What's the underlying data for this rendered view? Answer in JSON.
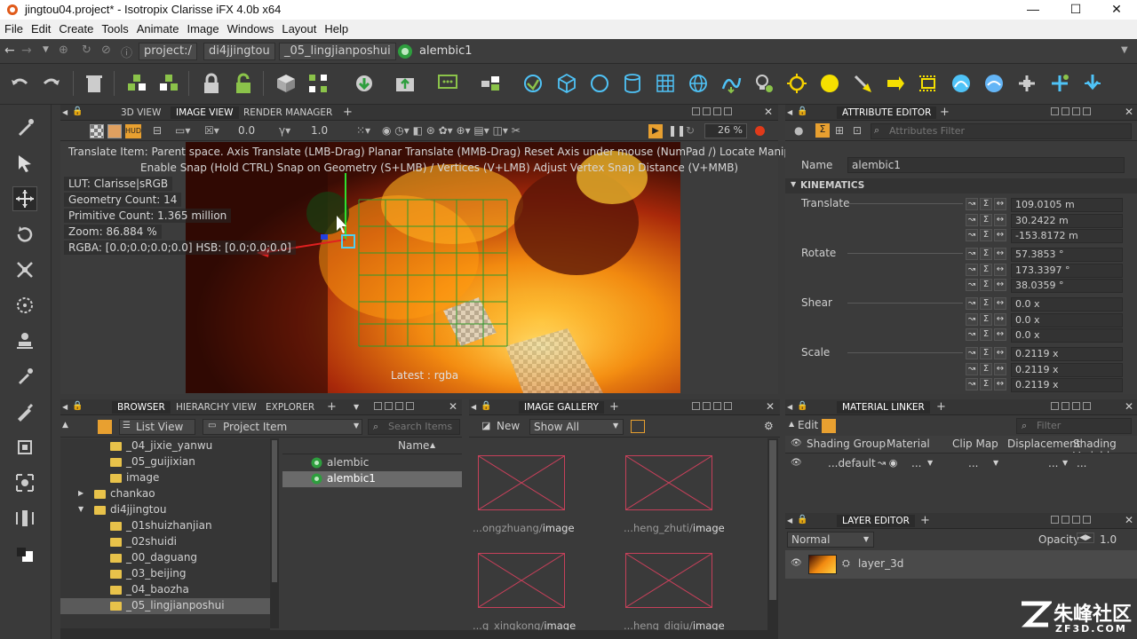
{
  "window": {
    "title": "jingtou04.project* - Isotropix Clarisse iFX 4.0b x64",
    "min": "—",
    "max": "☐",
    "close": "✕"
  },
  "menu": [
    "File",
    "Edit",
    "Create",
    "Tools",
    "Animate",
    "Image",
    "Windows",
    "Layout",
    "Help"
  ],
  "path": [
    "project:/",
    "di4jjingtou",
    "_05_lingjianposhui",
    "alembic1"
  ],
  "viewer": {
    "tabs": [
      "3D VIEW",
      "IMAGE VIEW",
      "RENDER MANAGER"
    ],
    "exposure": "0.0",
    "gamma": "1.0",
    "zoom": "26 %",
    "tip1": "Translate Item: Parent space. Axis Translate (LMB-Drag)  Planar Translate (MMB-Drag) Reset Axis under mouse (NumPad /)  Locate Manipulator (M/X/O/",
    "tip2": "Enable Snap (Hold CTRL) Snap on Geometry (S+LMB) / Vertices (V+LMB) Adjust Vertex Snap Distance (V+MMB)",
    "lut": "LUT: Clarisse|sRGB",
    "geo": "Geometry Count: 14",
    "prim": "Primitive Count: 1.365 million",
    "zoomhud": "Zoom: 86.884 %",
    "rgba": "RGBA: [0.0;0.0;0.0;0.0] HSB: [0.0;0.0;0.0]",
    "latest": "Latest : rgba"
  },
  "attr": {
    "title": "ATTRIBUTE EDITOR",
    "filter": "Attributes Filter",
    "name_label": "Name",
    "name": "alembic1",
    "section": "KINEMATICS",
    "groups": [
      {
        "label": "Translate",
        "values": [
          "109.0105 m",
          "30.2422 m",
          "-153.8172 m"
        ]
      },
      {
        "label": "Rotate",
        "values": [
          "57.3853 °",
          "173.3397 °",
          "38.0359 °"
        ]
      },
      {
        "label": "Shear",
        "values": [
          "0.0 x",
          "0.0 x",
          "0.0 x"
        ]
      },
      {
        "label": "Scale",
        "values": [
          "0.2119 x",
          "0.2119 x",
          "0.2119 x"
        ]
      }
    ]
  },
  "browser": {
    "tabs": [
      "BROWSER",
      "HIERARCHY VIEW",
      "EXPLORER"
    ],
    "view": "List View",
    "type": "Project Item",
    "search": "Search Items",
    "col": "Name",
    "tree": [
      "_04_jixie_yanwu",
      "_05_guijixian",
      "image",
      "chankao",
      "di4jjingtou",
      "_01shuizhanjian",
      "_02shuidi",
      "_00_daguang",
      "_03_beijing",
      "_04_baozha",
      "_05_lingjianposhui"
    ],
    "items": [
      "alembic",
      "alembic1"
    ]
  },
  "gallery": {
    "title": "IMAGE GALLERY",
    "new": "New",
    "filter": "Show All",
    "labels": [
      {
        "dim": "...ongzhuang/",
        "bright": "image"
      },
      {
        "dim": "...heng_zhuti/",
        "bright": "image"
      },
      {
        "dim": "...g_xingkong/",
        "bright": "image"
      },
      {
        "dim": "...heng_digiu/",
        "bright": "image"
      }
    ]
  },
  "material": {
    "title": "MATERIAL LINKER",
    "edit": "Edit",
    "filter": "Filter",
    "cols": [
      "Shading Group",
      "Material",
      "Clip Map",
      "Displacement",
      "Shading Variable"
    ],
    "row": "...default",
    "dots": "..."
  },
  "layer": {
    "title": "LAYER EDITOR",
    "mode": "Normal",
    "opacity_label": "Opacity",
    "opacity": "1.0",
    "layer": "layer_3d"
  },
  "watermark": {
    "brand": "朱峰社区",
    "url": "ZF3D.COM"
  }
}
